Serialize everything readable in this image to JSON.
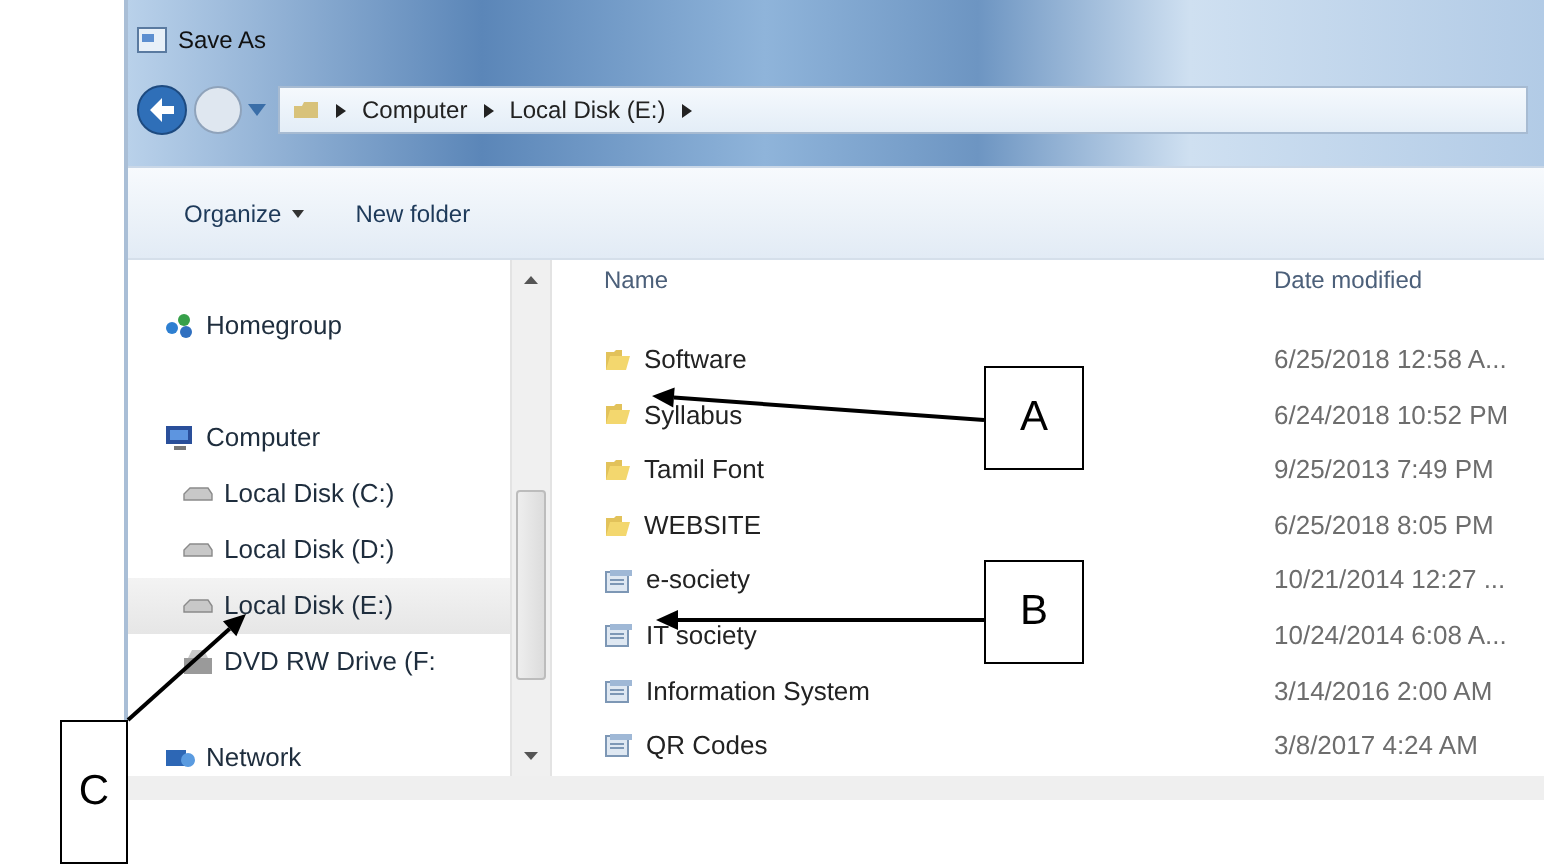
{
  "window": {
    "title": "Save As"
  },
  "address_bar": {
    "crumbs": [
      "Computer",
      "Local Disk (E:)"
    ]
  },
  "toolbar": {
    "buttons": [
      {
        "label": "Organize",
        "dropdown": true
      },
      {
        "label": "New folder",
        "dropdown": false
      }
    ]
  },
  "navigation": {
    "items": [
      {
        "label": "Homegroup",
        "kind": "homegroup",
        "selected": false
      },
      {
        "label": "Computer",
        "kind": "computer",
        "selected": false,
        "children": [
          {
            "label": "Local Disk (C:)",
            "kind": "disk",
            "selected": false
          },
          {
            "label": "Local Disk (D:)",
            "kind": "disk",
            "selected": false
          },
          {
            "label": "Local Disk (E:)",
            "kind": "disk",
            "selected": true
          },
          {
            "label": "DVD RW Drive (F:",
            "kind": "dvd",
            "selected": false
          }
        ]
      },
      {
        "label": "Network",
        "kind": "network",
        "selected": false
      }
    ]
  },
  "file_list": {
    "columns": [
      "Name",
      "Date modified"
    ],
    "rows": [
      {
        "name": "Software",
        "date": "6/25/2018 12:58 A...",
        "kind": "folder"
      },
      {
        "name": "Syllabus",
        "date": "6/24/2018 10:52 PM",
        "kind": "folder"
      },
      {
        "name": "Tamil Font",
        "date": "9/25/2013 7:49 PM",
        "kind": "folder"
      },
      {
        "name": "WEBSITE",
        "date": "6/25/2018 8:05 PM",
        "kind": "folder"
      },
      {
        "name": "e-society",
        "date": "10/21/2014 12:27 ...",
        "kind": "library"
      },
      {
        "name": "IT society",
        "date": "10/24/2014 6:08 A...",
        "kind": "library"
      },
      {
        "name": "Information System",
        "date": "3/14/2016 2:00 AM",
        "kind": "library"
      },
      {
        "name": "QR Codes",
        "date": "3/8/2017 4:24 AM",
        "kind": "library"
      }
    ]
  },
  "annotations": [
    {
      "label": "A"
    },
    {
      "label": "B"
    },
    {
      "label": "C"
    }
  ]
}
